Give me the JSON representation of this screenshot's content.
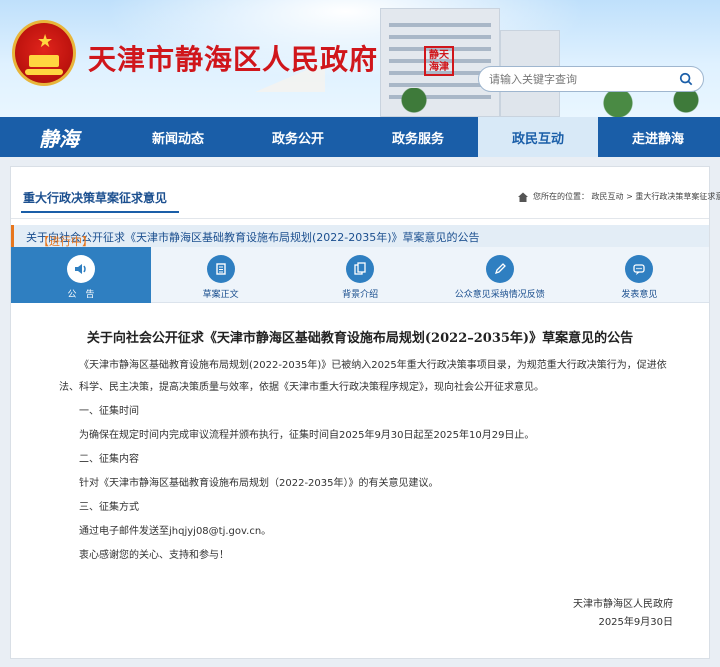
{
  "header": {
    "site_title": "天津市静海区人民政府",
    "seal_text": "静天海津",
    "search_placeholder": "请输入关键字查询"
  },
  "nav": {
    "logo_text": "静海",
    "items": [
      "新闻动态",
      "政务公开",
      "政务服务",
      "政民互动",
      "走进静海"
    ],
    "active_index": 3
  },
  "section": {
    "title": "重大行政决策草案征求意见",
    "breadcrumb": "您所在的位置：  政民互动  >  重大行政决策草案征求意见"
  },
  "notice": {
    "tag": "【进行中】",
    "text": "关于向社会公开征求《天津市静海区基础教育设施布局规划(2022-2035年)》草案意见的公告"
  },
  "tabs": [
    {
      "label": "公　告",
      "icon": "speaker-icon"
    },
    {
      "label": "草案正文",
      "icon": "document-icon"
    },
    {
      "label": "背景介绍",
      "icon": "files-icon"
    },
    {
      "label": "公众意见采纳情况反馈",
      "icon": "pen-icon"
    },
    {
      "label": "发表意见",
      "icon": "chat-icon"
    }
  ],
  "article": {
    "title": "关于向社会公开征求《天津市静海区基础教育设施布局规划(2022–2035年)》草案意见的公告",
    "intro": "《天津市静海区基础教育设施布局规划(2022-2035年)》已被纳入2025年重大行政决策事项目录，为规范重大行政决策行为，促进依法、科学、民主决策，提高决策质量与效率，依据《天津市重大行政决策程序规定》，现向社会公开征求意见。",
    "h1": "一、征集时间",
    "p1": "为确保在规定时间内完成审议流程并颁布执行，征集时间自2025年9月30日起至2025年10月29日止。",
    "h2": "二、征集内容",
    "p2": "针对《天津市静海区基础教育设施布局规划（2022-2035年）》的有关意见建议。",
    "h3": "三、征集方式",
    "p3": "通过电子邮件发送至jhqjyj08@tj.gov.cn。",
    "thanks": "衷心感谢您的关心、支持和参与！",
    "sign_org": "天津市静海区人民政府",
    "sign_date": "2025年9月30日"
  },
  "colors": {
    "nav_bg": "#1a5ea8",
    "title_red": "#d0161b",
    "accent_orange": "#e7761d",
    "tab_active": "#2f7fc1"
  }
}
